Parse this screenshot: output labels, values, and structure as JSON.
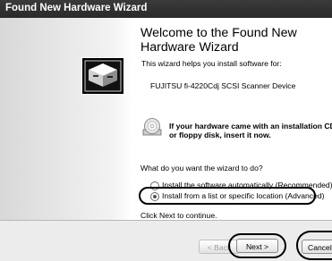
{
  "window": {
    "title": "Found New Hardware Wizard"
  },
  "wizard": {
    "heading": "Welcome to the Found New Hardware Wizard",
    "intro": "This wizard helps you install software for:",
    "device": "FUJITSU fi-4220Cdj SCSI Scanner Device",
    "cd_prompt_line1": "If your hardware came with an installation CD",
    "cd_prompt_line2": "or floppy disk, insert it now.",
    "question": "What do you want the wizard to do?",
    "options": [
      {
        "label": "Install the software automatically (Recommended)",
        "selected": false
      },
      {
        "label": "Install from a list or specific location (Advanced)",
        "selected": true
      }
    ],
    "continue_hint": "Click Next to continue."
  },
  "buttons": {
    "back": "< Back",
    "next": "Next >",
    "cancel": "Cancel"
  },
  "icons": {
    "hardware": "hardware-wizard-icon",
    "cd": "cd-icon"
  }
}
